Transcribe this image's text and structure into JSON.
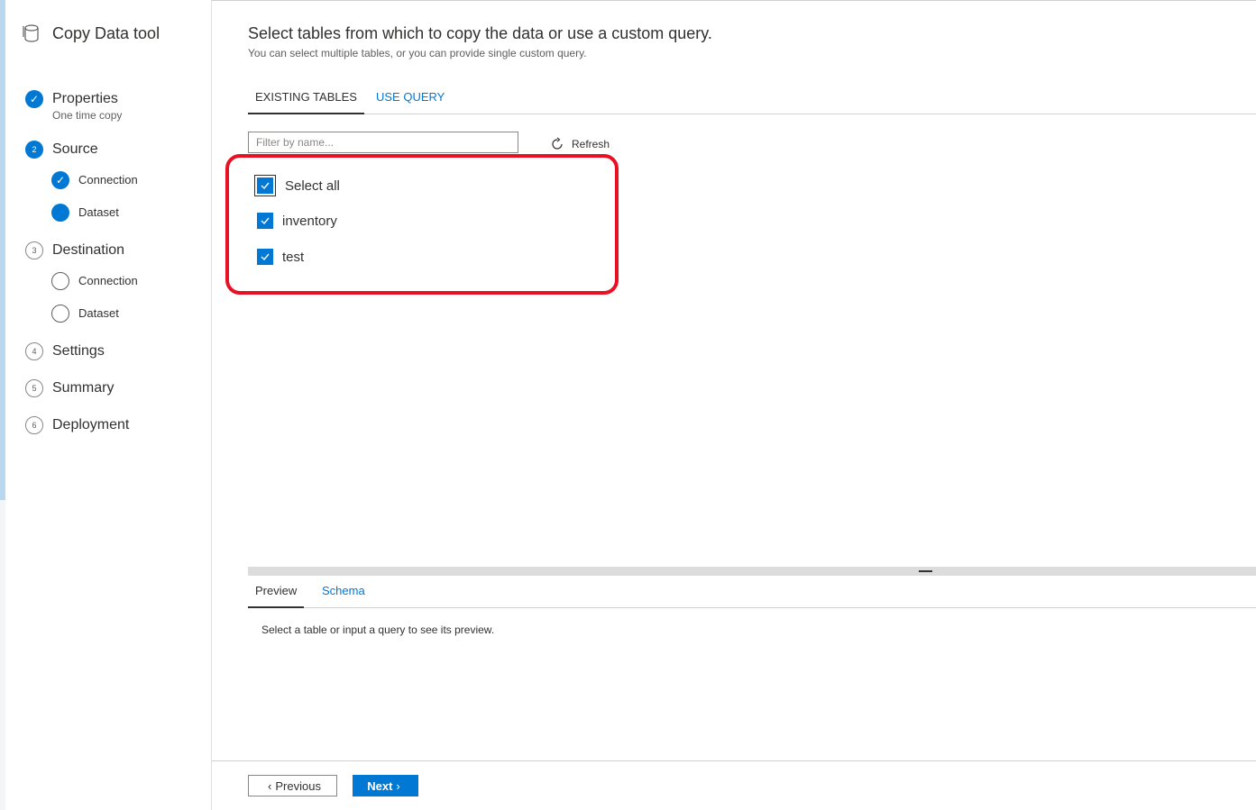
{
  "app": {
    "title": "Copy Data tool",
    "icon": "database-icon"
  },
  "steps": [
    {
      "label": "Properties",
      "sublabel": "One time copy",
      "state": "done",
      "number": "1"
    },
    {
      "label": "Source",
      "state": "active",
      "number": "2",
      "substeps": [
        {
          "label": "Connection",
          "state": "done"
        },
        {
          "label": "Dataset",
          "state": "active"
        }
      ]
    },
    {
      "label": "Destination",
      "state": "pending",
      "number": "3",
      "substeps": [
        {
          "label": "Connection",
          "state": "pending"
        },
        {
          "label": "Dataset",
          "state": "pending"
        }
      ]
    },
    {
      "label": "Settings",
      "state": "pending",
      "number": "4"
    },
    {
      "label": "Summary",
      "state": "pending",
      "number": "5"
    },
    {
      "label": "Deployment",
      "state": "pending",
      "number": "6"
    }
  ],
  "main": {
    "heading": "Select tables from which to copy the data or use a custom query.",
    "subheading": "You can select multiple tables, or you can provide single custom query.",
    "tabs": [
      {
        "label": "EXISTING TABLES",
        "active": true
      },
      {
        "label": "USE QUERY",
        "active": false
      }
    ],
    "filter": {
      "placeholder": "Filter by name...",
      "value": ""
    },
    "refresh_label": "Refresh",
    "select_all": {
      "label": "Select all",
      "checked": true
    },
    "tables": [
      {
        "label": "inventory",
        "checked": true
      },
      {
        "label": "test",
        "checked": true
      }
    ]
  },
  "preview": {
    "tabs": [
      {
        "label": "Preview",
        "active": true
      },
      {
        "label": "Schema",
        "active": false
      }
    ],
    "message": "Select a table or input a query to see its preview."
  },
  "footer": {
    "previous_label": "Previous",
    "next_label": "Next"
  },
  "colors": {
    "accent": "#0078d4",
    "highlight": "#e81123"
  }
}
